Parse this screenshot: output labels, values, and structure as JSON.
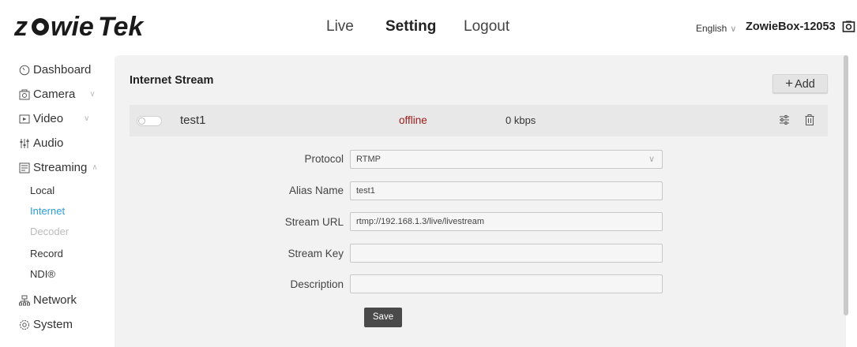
{
  "brand": {
    "logo_text": "ZowieTek"
  },
  "topnav": {
    "live": "Live",
    "setting": "Setting",
    "logout": "Logout"
  },
  "header": {
    "language": "English",
    "device_name": "ZowieBox-12053"
  },
  "sidebar": {
    "dashboard": "Dashboard",
    "camera": "Camera",
    "video": "Video",
    "audio": "Audio",
    "streaming": "Streaming",
    "sub": {
      "local": "Local",
      "internet": "Internet",
      "decoder": "Decoder",
      "record": "Record",
      "ndi": "NDI®"
    },
    "network": "Network",
    "system": "System"
  },
  "panel": {
    "title": "Internet Stream",
    "add_label": "Add"
  },
  "stream": {
    "name": "test1",
    "status": "offline",
    "bitrate": "0 kbps",
    "enabled": false
  },
  "form": {
    "protocol_label": "Protocol",
    "protocol_value": "RTMP",
    "alias_label": "Alias Name",
    "alias_value": "test1",
    "url_label": "Stream URL",
    "url_value": "rtmp://192.168.1.3/live/livestream",
    "key_label": "Stream Key",
    "key_value": "",
    "desc_label": "Description",
    "desc_value": "",
    "save_label": "Save"
  },
  "colors": {
    "accent": "#2a9fd8",
    "offline": "#9a1a1a",
    "save_bg": "#4a4a4a"
  }
}
